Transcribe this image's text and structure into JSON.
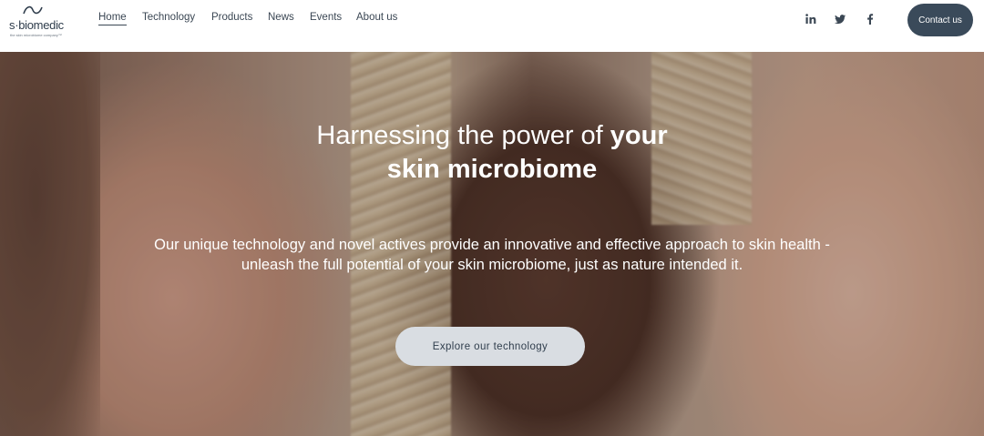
{
  "header": {
    "logo_text": "s·biomedic",
    "logo_tagline": "the skin microbiome company™",
    "nav": [
      {
        "label": "Home",
        "active": true
      },
      {
        "label": "Technology",
        "active": false
      },
      {
        "label": "Products",
        "active": false
      },
      {
        "label": "News",
        "active": false
      },
      {
        "label": "Events",
        "active": false
      },
      {
        "label": "About us",
        "active": false
      }
    ],
    "social_icons": [
      "linkedin-icon",
      "twitter-icon",
      "facebook-icon"
    ],
    "contact_label": "Contact us"
  },
  "hero": {
    "title_regular": "Harnessing the power of ",
    "title_bold_1": "your",
    "title_bold_2": "skin microbiome",
    "description": "Our unique technology and novel actives provide an innovative and effective approach to skin health - unleash the full potential of your skin microbiome, just as nature intended it.",
    "cta_label": "Explore our technology"
  },
  "colors": {
    "nav_text": "#3b4754",
    "contact_button": "#3a4a5a",
    "cta_button": "#d9dde2",
    "hero_text": "#ffffff"
  }
}
